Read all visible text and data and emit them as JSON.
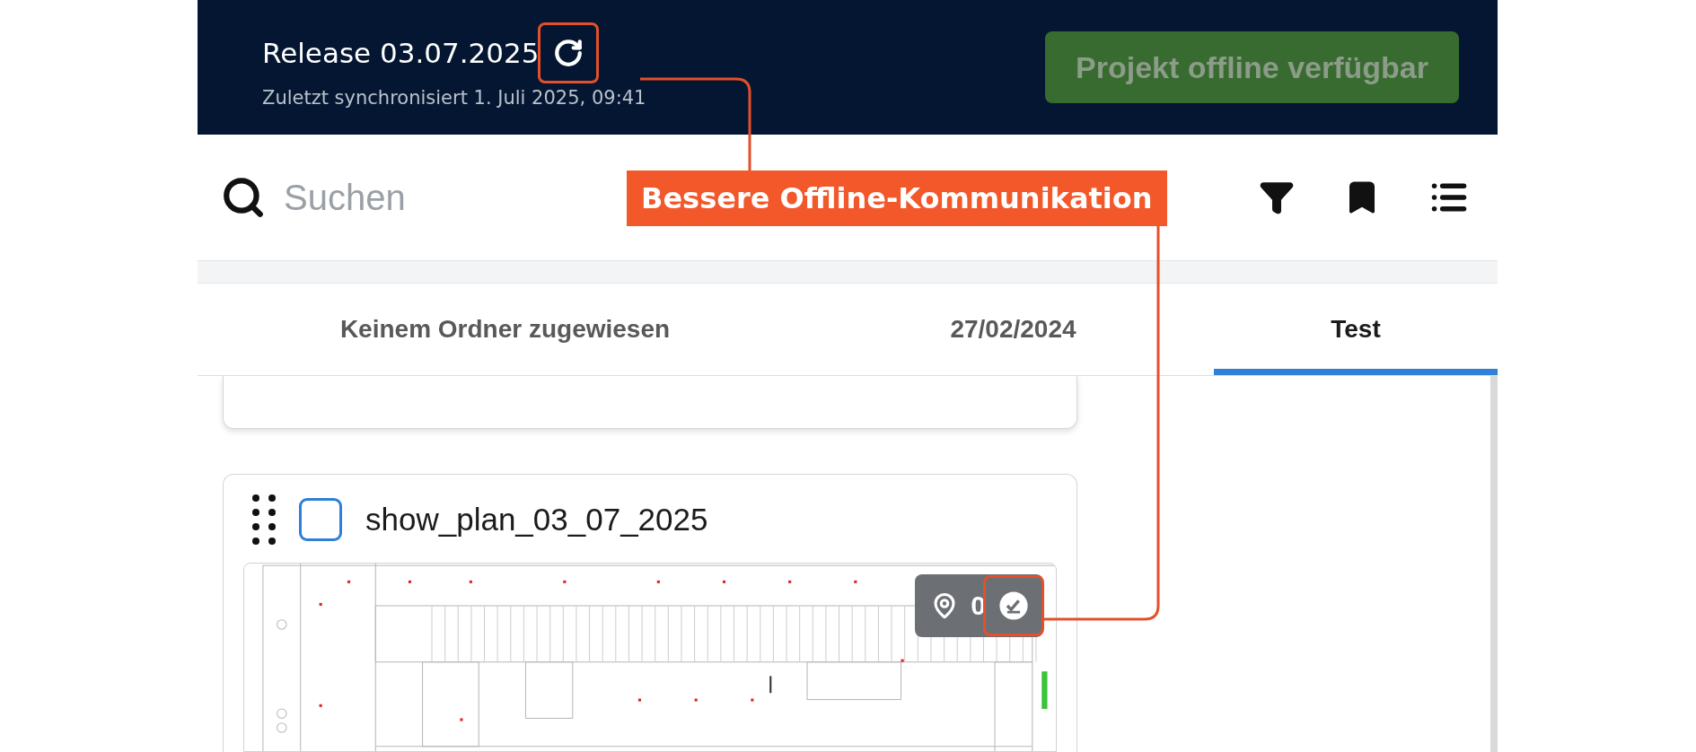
{
  "header": {
    "title": "Release 03.07.2025",
    "sync_status": "Zuletzt synchronisiert 1. Juli 2025, 09:41",
    "offline_button": {
      "label": "Projekt offline verfügbar",
      "disabled": true
    }
  },
  "search": {
    "placeholder": "Suchen"
  },
  "tabs": [
    {
      "label": "Keinem Ordner zugewiesen",
      "selected": false
    },
    {
      "label": "27/02/2024",
      "selected": false
    },
    {
      "label": "Test",
      "selected": true
    }
  ],
  "plans": [
    {
      "name": "show_plan_03_07_2025",
      "checked": false,
      "badge": {
        "count": "0"
      }
    }
  ],
  "annotation": {
    "label": "Bessere Offline-Kommunikation"
  }
}
